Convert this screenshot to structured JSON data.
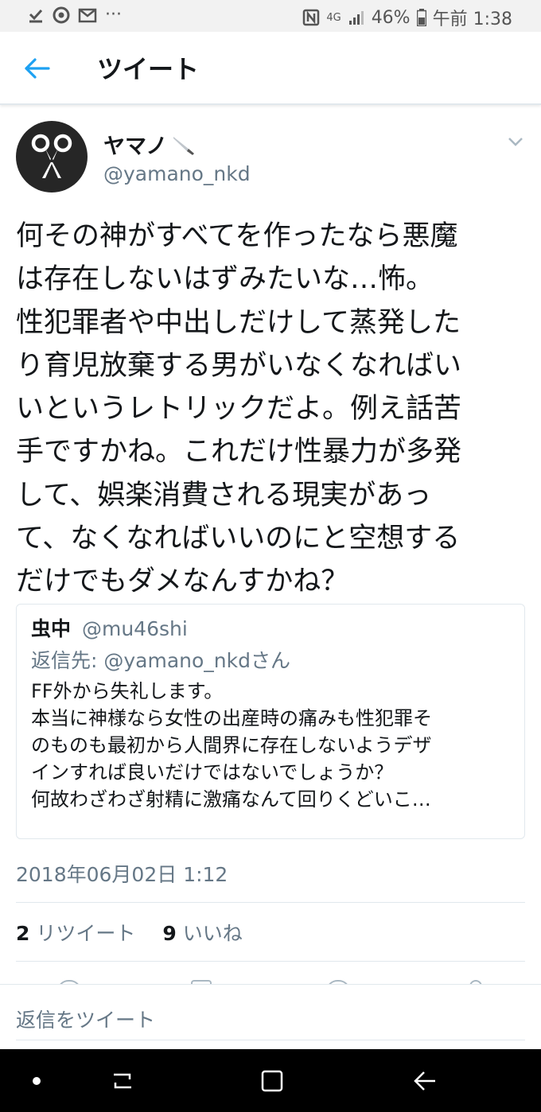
{
  "status_bar": {
    "battery": "46%",
    "time": "午前 1:38",
    "network": "4G",
    "dots": "···"
  },
  "header": {
    "title": "ツイート"
  },
  "tweet": {
    "author_name": "ヤマノ",
    "author_handle": "@yamano_nkd",
    "text": "何その神がすべてを作ったなら悪魔\nは存在しないはずみたいな…怖。\n性犯罪者や中出しだけして蒸発した\nり育児放棄する男がいなくなればい\nいというレトリックだよ。例え話苦\n手ですかね。これだけ性暴力が多発\nして、娯楽消費される現実があっ\nて、なくなればいいのにと空想する\nだけでもダメなんすかね？",
    "timestamp": "2018年06月02日 1:12",
    "retweet_count": "2",
    "retweet_label": "リツイート",
    "like_count": "9",
    "like_label": "いいね"
  },
  "quoted_tweet": {
    "name": "虫中",
    "handle": "@mu46shi",
    "reply_to": "返信先: @yamano_nkdさん",
    "text": "FF外から失礼します。\n本当に神様なら女性の出産時の痛みも性犯罪そ\nのものも最初から人間界に存在しないようデザ\nインすれば良いだけではないでしょうか？\n何故わざわざ射精に激痛なんて回りくどいこ…"
  },
  "reply_bar": {
    "placeholder": "返信をツイート"
  },
  "colors": {
    "accent": "#1da1f2",
    "secondary_text": "#657786",
    "divider": "#e1e8ed"
  }
}
